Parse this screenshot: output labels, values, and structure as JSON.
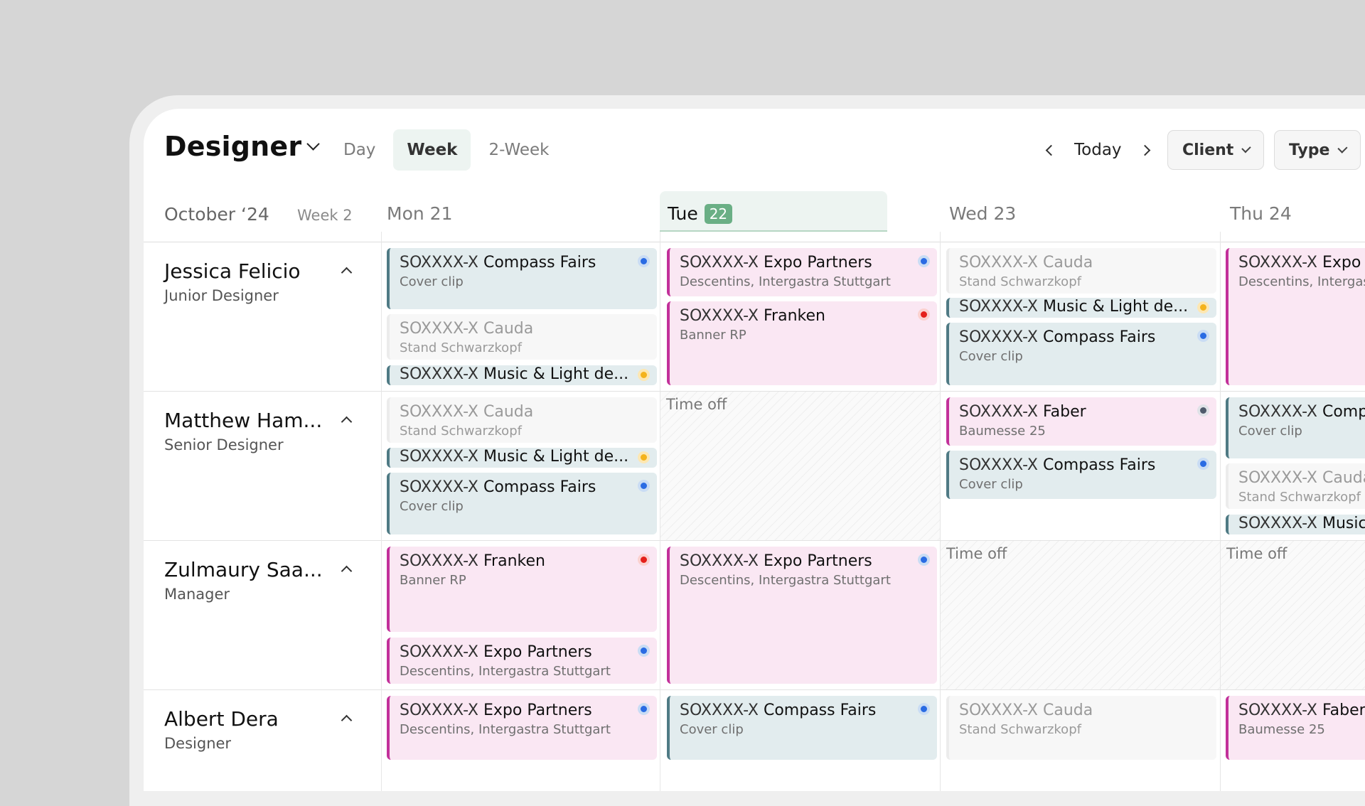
{
  "header": {
    "title": "Designer",
    "views": [
      "Day",
      "Week",
      "2-Week"
    ],
    "active_view": "Week",
    "today_label": "Today",
    "filters": [
      "Client",
      "Type"
    ]
  },
  "calendar": {
    "month": "October ‘24",
    "week": "Week 2",
    "days": [
      {
        "label": "Mon 21"
      },
      {
        "label": "Tue",
        "badge": "22"
      },
      {
        "label": "Wed 23"
      },
      {
        "label": "Thu 24"
      }
    ]
  },
  "people": [
    {
      "name": "Jessica Felicio",
      "role": "Junior Designer"
    },
    {
      "name": "Matthew Ham...",
      "role": "Senior Designer"
    },
    {
      "name": "Zulmaury Saa...",
      "role": "Manager"
    },
    {
      "name": "Albert Dera",
      "role": "Designer"
    }
  ],
  "time_off_label": "Time off",
  "events": [
    {
      "code": "SOXXXX-X",
      "name": "Compass Fairs",
      "sub": "Cover clip",
      "type": "teal",
      "status": "blue"
    },
    {
      "code": "SOXXXX-X",
      "name": "Cauda",
      "sub": "Stand Schwarzkopf",
      "type": "gray"
    },
    {
      "code": "SOXXXX-X",
      "name": "Music & Light de...",
      "type": "teal",
      "status": "yellow"
    },
    {
      "code": "SOXXXX-X",
      "name": "Expo Partners",
      "sub": "Descentins, Intergastra Stuttgart",
      "type": "pink",
      "status": "blue"
    },
    {
      "code": "SOXXXX-X",
      "name": "Franken",
      "sub": "Banner RP",
      "type": "pink",
      "status": "red"
    },
    {
      "code": "SOXXXX-X",
      "name": "Cauda",
      "sub": "Stand Schwarzkopf",
      "type": "gray"
    },
    {
      "code": "SOXXXX-X",
      "name": "Music & Light de...",
      "type": "teal",
      "status": "yellow"
    },
    {
      "code": "SOXXXX-X",
      "name": "Compass Fairs",
      "sub": "Cover clip",
      "type": "teal",
      "status": "blue"
    },
    {
      "code": "SOXXXX-X",
      "name": "Expo",
      "sub": "Descentins, Intergastra",
      "type": "pink"
    },
    {
      "code": "SOXXXX-X",
      "name": "Cauda",
      "sub": "Stand Schwarzkopf",
      "type": "gray"
    },
    {
      "code": "SOXXXX-X",
      "name": "Music & Light de...",
      "type": "teal",
      "status": "yellow"
    },
    {
      "code": "SOXXXX-X",
      "name": "Compass Fairs",
      "sub": "Cover clip",
      "type": "teal",
      "status": "blue"
    },
    {
      "code": "SOXXXX-X",
      "name": "Faber",
      "sub": "Baumesse 25",
      "type": "pink",
      "status": "slate"
    },
    {
      "code": "SOXXXX-X",
      "name": "Compass Fairs",
      "sub": "Cover clip",
      "type": "teal",
      "status": "blue"
    },
    {
      "code": "SOXXXX-X",
      "name": "Comp",
      "sub": "Cover clip",
      "type": "teal"
    },
    {
      "code": "SOXXXX-X",
      "name": "Cauda",
      "sub": "Stand Schwarzkopf",
      "type": "gray"
    },
    {
      "code": "SOXXXX-X",
      "name": "Music",
      "type": "teal"
    },
    {
      "code": "SOXXXX-X",
      "name": "Franken",
      "sub": "Banner RP",
      "type": "pink",
      "status": "red"
    },
    {
      "code": "SOXXXX-X",
      "name": "Expo Partners",
      "sub": "Descentins, Intergastra Stuttgart",
      "type": "pink",
      "status": "blue"
    },
    {
      "code": "SOXXXX-X",
      "name": "Expo Partners",
      "sub": "Descentins, Intergastra Stuttgart",
      "type": "pink",
      "status": "blue"
    },
    {
      "code": "SOXXXX-X",
      "name": "Expo Partners",
      "sub": "Descentins, Intergastra Stuttgart",
      "type": "pink",
      "status": "blue"
    },
    {
      "code": "SOXXXX-X",
      "name": "Compass Fairs",
      "sub": "Cover clip",
      "type": "teal",
      "status": "blue"
    },
    {
      "code": "SOXXXX-X",
      "name": "Cauda",
      "sub": "Stand Schwarzkopf",
      "type": "gray"
    },
    {
      "code": "SOXXXX-X",
      "name": "Faber",
      "sub": "Baumesse 25",
      "type": "pink"
    }
  ],
  "colors": {
    "teal_event": "#e2ecee",
    "pink_event": "#fae7f3",
    "today_badge": "#6aaf85",
    "status_blue": "#2a6be3",
    "status_red": "#e4201a",
    "status_yellow": "#f4b31c"
  }
}
